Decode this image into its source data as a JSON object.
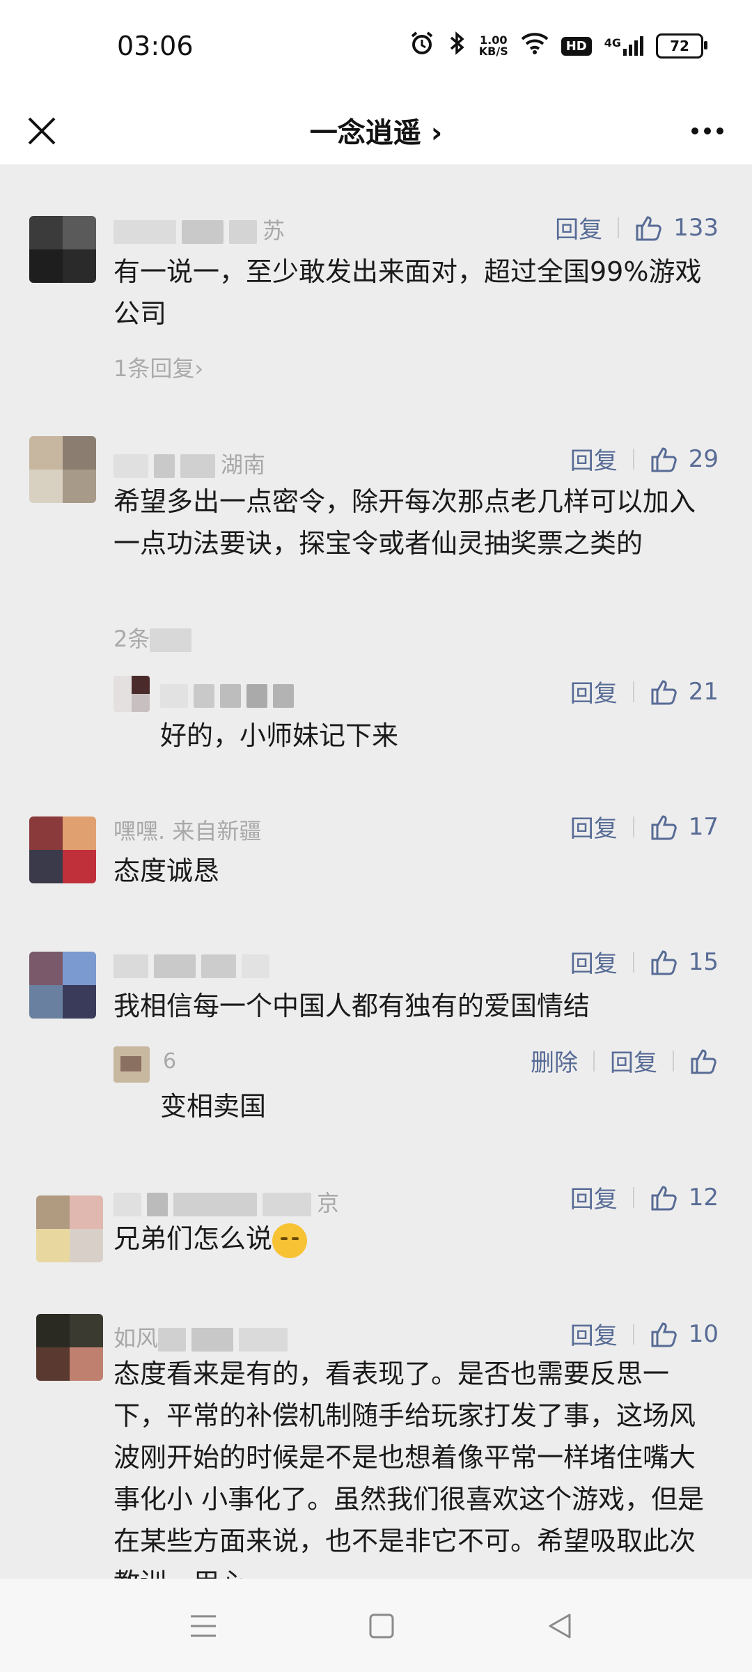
{
  "status": {
    "time": "03:06",
    "net_speed_top": "1.00",
    "net_speed_bottom": "KB/S",
    "hd": "HD",
    "signal": "4G",
    "battery": "72"
  },
  "header": {
    "title": "一念逍遥 ›"
  },
  "comments": [
    {
      "author_partial": "苏",
      "reply_label": "回复",
      "likes": "133",
      "content": "有一说一，至少敢发出来面对，超过全国99%游戏公司",
      "more": "1条回复›"
    },
    {
      "author_partial": "湖南",
      "reply_label": "回复",
      "likes": "29",
      "content": "希望多出一点密令，除开每次那点老几样可以加入一点功法要诀，探宝令或者仙灵抽奖票之类的",
      "more": "2条",
      "reply": {
        "reply_label": "回复",
        "likes": "21",
        "content": "好的，小师妹记下来"
      }
    },
    {
      "author": "嘿嘿. 来自新疆",
      "reply_label": "回复",
      "likes": "17",
      "content": "态度诚恳"
    },
    {
      "reply_label": "回复",
      "likes": "15",
      "content": "我相信每一个中国人都有独有的爱国情结",
      "reply": {
        "author": "6",
        "delete_label": "删除",
        "reply_label": "回复",
        "content": "变相卖国"
      }
    },
    {
      "author_partial": "京",
      "reply_label": "回复",
      "likes": "12",
      "content": "兄弟们怎么说"
    },
    {
      "author_partial": "如风",
      "reply_label": "回复",
      "likes": "10",
      "content": "态度看来是有的，看表现了。是否也需要反思一下，平常的补偿机制随手给玩家打发了事，这场风波刚开始的时候是不是也想着像平常一样堵住嘴大事化小 小事化了。虽然我们很喜欢这个游戏，但是在某些方面来说，也不是非它不可。希望吸取此次教训，用心"
    }
  ],
  "colors": {
    "link": "#576b95",
    "background": "#ededed"
  }
}
